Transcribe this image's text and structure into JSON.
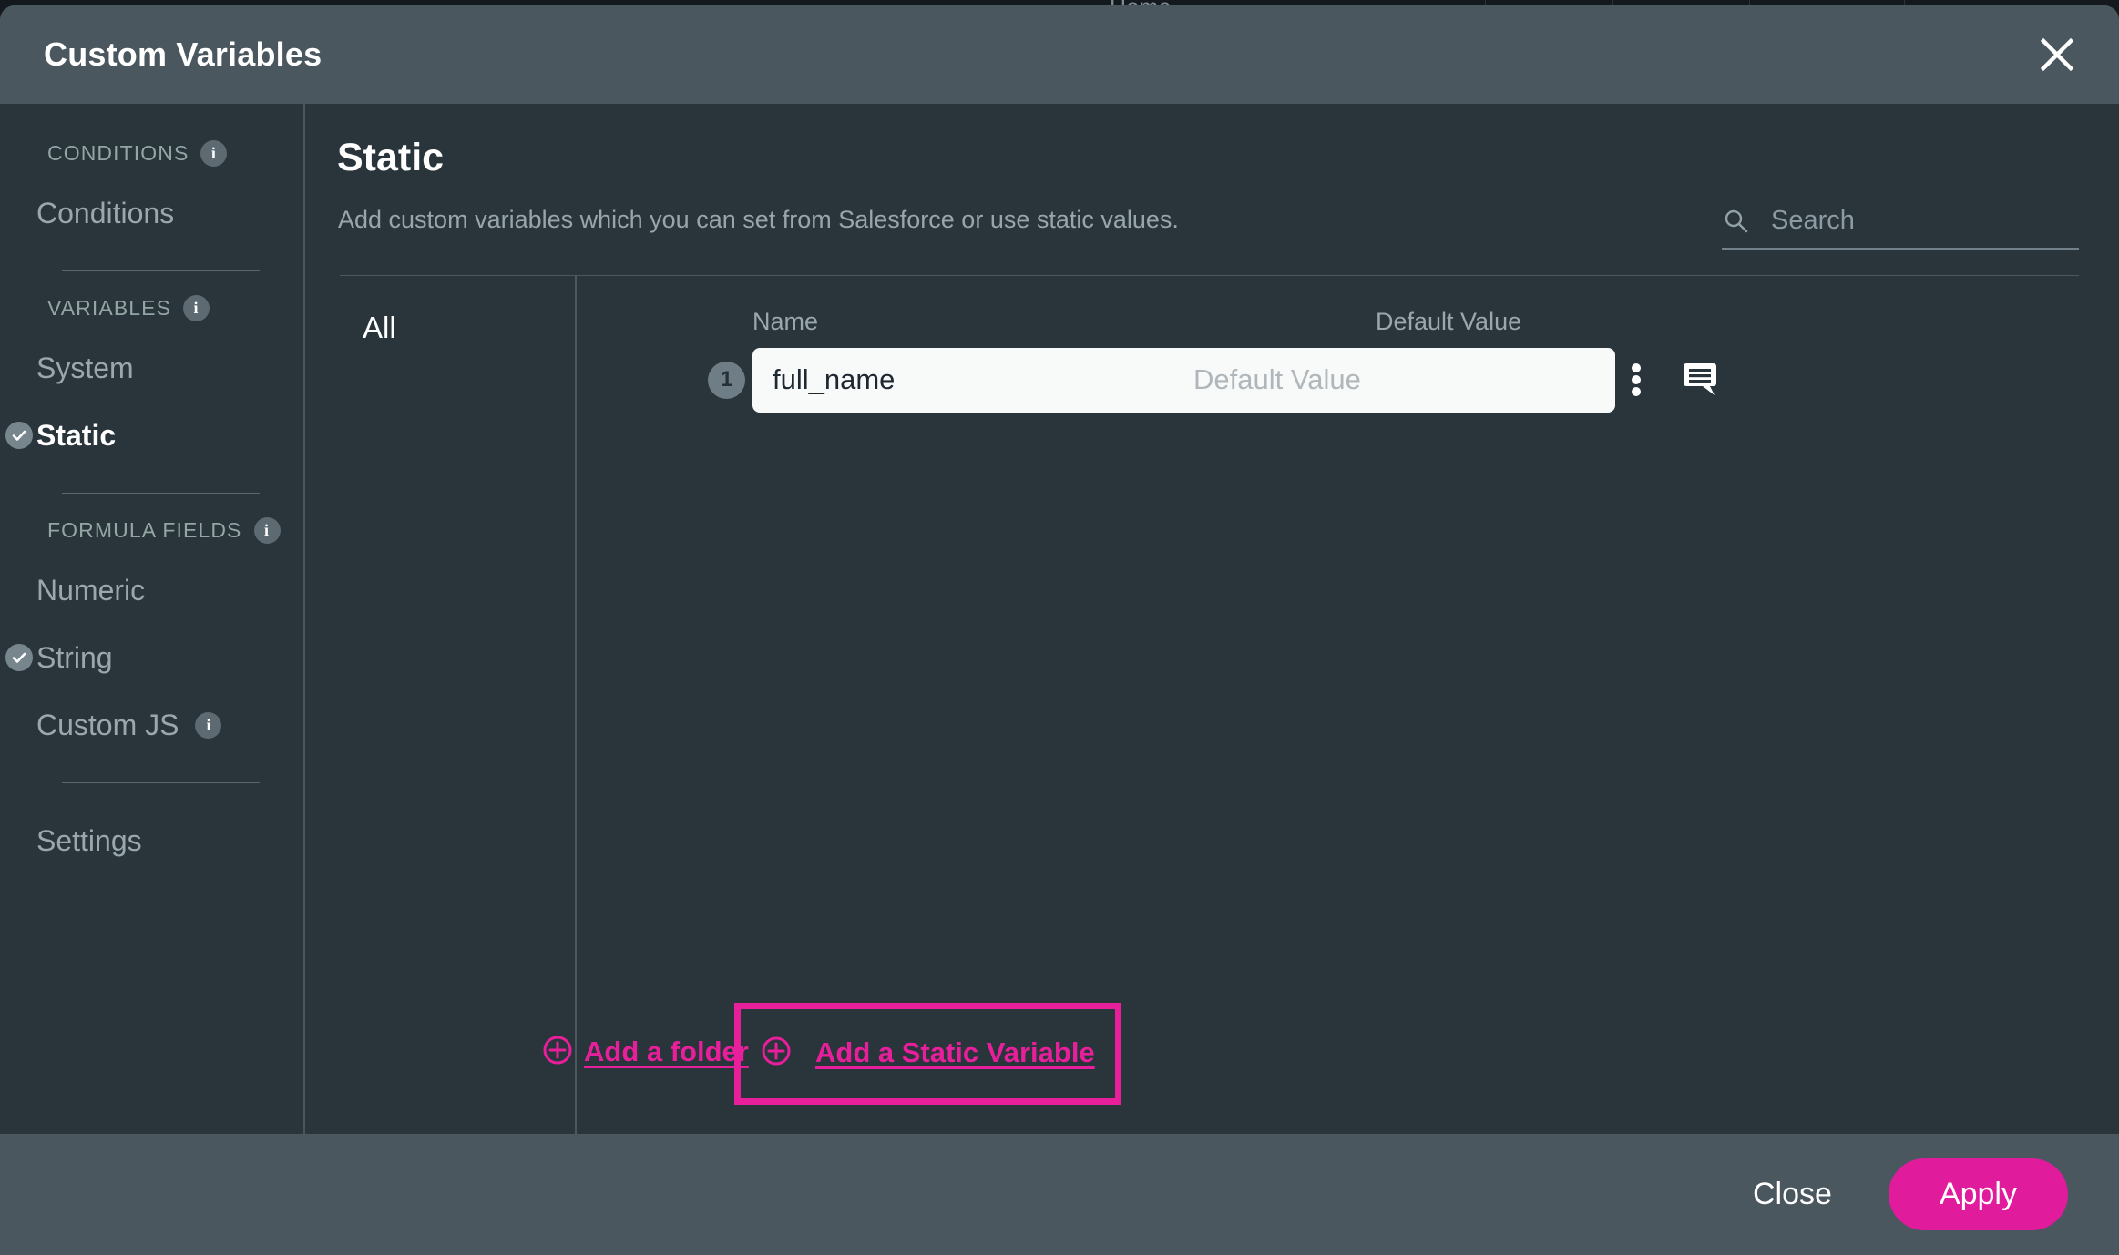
{
  "backdrop": {
    "home_label": "Home",
    "caret": "▾"
  },
  "modal": {
    "title": "Custom Variables",
    "close_icon": "close-icon"
  },
  "sidebar": {
    "groups": [
      {
        "label": "CONDITIONS",
        "info_icon": "info-icon",
        "items": [
          {
            "label": "Conditions",
            "active": false,
            "checked": false
          }
        ]
      },
      {
        "label": "VARIABLES",
        "info_icon": "info-icon",
        "items": [
          {
            "label": "System",
            "active": false,
            "checked": false
          },
          {
            "label": "Static",
            "active": true,
            "checked": true
          }
        ]
      },
      {
        "label": "FORMULA FIELDS",
        "info_icon": "info-icon",
        "items": [
          {
            "label": "Numeric",
            "active": false,
            "checked": false
          },
          {
            "label": "String",
            "active": false,
            "checked": true
          },
          {
            "label": "Custom JS",
            "active": false,
            "checked": false,
            "info_icon": "info-icon"
          }
        ]
      }
    ],
    "settings_label": "Settings"
  },
  "main": {
    "title": "Static",
    "subtitle": "Add custom variables which you can set from Salesforce or use static values.",
    "search": {
      "placeholder": "Search",
      "value": "",
      "search_icon": "search-icon",
      "clear_icon": "clear-circle-icon"
    },
    "folder_column": {
      "all_label": "All"
    },
    "table": {
      "headers": {
        "name": "Name",
        "default_value": "Default Value"
      },
      "rows": [
        {
          "index": "1",
          "name": "full_name",
          "default_value": "",
          "default_value_placeholder": "Default Value",
          "menu_icon": "more-vertical-icon",
          "comment_icon": "comment-icon"
        }
      ]
    },
    "add_folder_label": "Add a folder",
    "add_static_label": "Add a Static Variable",
    "plus_icon": "plus-circle-icon"
  },
  "footer": {
    "close_label": "Close",
    "apply_label": "Apply"
  },
  "colors": {
    "accent": "#e01b9c",
    "highlight_box": "#e81f9a",
    "header_bg": "#4b575e",
    "body_bg": "#29343b",
    "muted_text": "#9aa7ad"
  }
}
